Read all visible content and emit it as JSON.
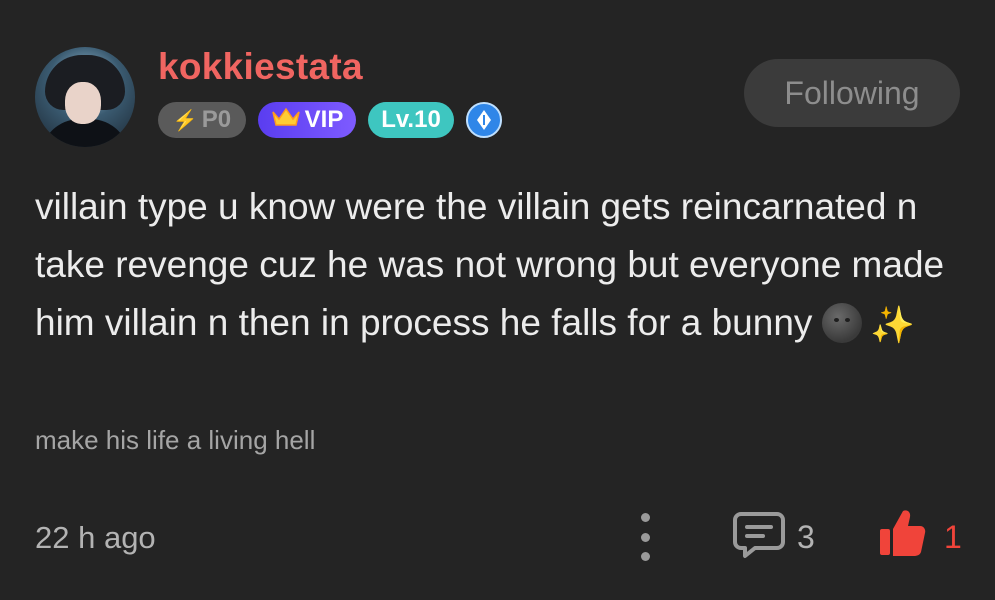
{
  "user": {
    "name": "kokkiestata",
    "badges": {
      "p0": "P0",
      "vip": "VIP",
      "level": "Lv.10"
    }
  },
  "follow_button": "Following",
  "post": {
    "body": "villain type u know were the villain gets reincarnated n take revenge cuz he was not wrong but everyone made him villain n then in process he falls for a bunny",
    "subtitle": "make his life a living hell",
    "time": "22 h ago"
  },
  "actions": {
    "comments": "3",
    "likes": "1"
  },
  "colors": {
    "background": "#242424",
    "username": "#f06561",
    "like": "#f0443a"
  },
  "icons": [
    "avatar",
    "bolt-icon",
    "crown-icon",
    "quill-icon",
    "more-icon",
    "comment-icon",
    "thumbs-up-icon",
    "moon-face-emoji",
    "sparkles-emoji"
  ]
}
